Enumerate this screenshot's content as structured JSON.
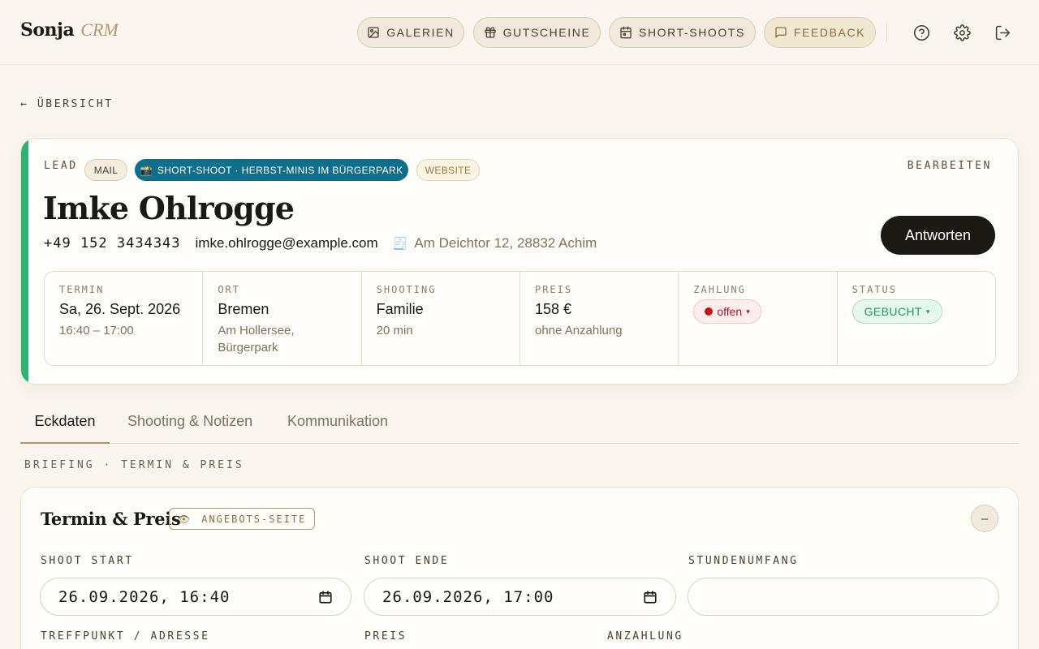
{
  "brand": {
    "name": "Sonja",
    "suffix": "CRM"
  },
  "nav": {
    "galerien": "GALERIEN",
    "gutscheine": "GUTSCHEINE",
    "short_shoots": "SHORT-SHOOTS",
    "feedback": "FEEDBACK"
  },
  "back_link": "← ÜBERSICHT",
  "lead": {
    "label": "LEAD",
    "chips": {
      "mail": "MAIL",
      "shoot": "SHORT-SHOOT · HERBST-MINIS IM BÜRGERPARK",
      "shoot_emoji": "📸",
      "source": "WEBSITE"
    },
    "edit": "BEARBEITEN",
    "name": "Imke Ohlrogge",
    "phone": "+49 152 3434343",
    "email": "imke.ohlrogge@example.com",
    "address": "Am Deichtor 12, 28832 Achim",
    "address_icon": "🧾",
    "reply_button": "Antworten",
    "accent_color": "#2db37a"
  },
  "facts": {
    "termin": {
      "label": "TERMIN",
      "main": "Sa, 26. Sept. 2026",
      "sub": "16:40 – 17:00"
    },
    "ort": {
      "label": "ORT",
      "main": "Bremen",
      "sub": "Am Hollersee, Bürgerpark"
    },
    "shooting": {
      "label": "SHOOTING",
      "main": "Familie",
      "sub": "20 min"
    },
    "preis": {
      "label": "PREIS",
      "main": "158 €",
      "sub": "ohne Anzahlung"
    },
    "zahlung": {
      "label": "ZAHLUNG",
      "value": "offen",
      "caret": "▾"
    },
    "status": {
      "label": "STATUS",
      "value": "GEBUCHT",
      "caret": "▾"
    }
  },
  "tabs": {
    "eckdaten": "Eckdaten",
    "shooting": "Shooting & Notizen",
    "kommunikation": "Kommunikation"
  },
  "section_label": "BRIEFING · TERMIN & PREIS",
  "panel": {
    "title": "Termin & Preis",
    "badge": "ANGEBOTS-SEITE",
    "badge_icon": "👁",
    "collapse": "–",
    "fields": {
      "shoot_start": {
        "label": "SHOOT START",
        "value": "26.09.2026, 16:40"
      },
      "shoot_ende": {
        "label": "SHOOT ENDE",
        "value": "26.09.2026, 17:00"
      },
      "stundenumfang": {
        "label": "STUNDENUMFANG",
        "value": ""
      },
      "treffpunkt": {
        "label": "TREFFPUNKT / ADRESSE"
      },
      "preis": {
        "label": "PREIS"
      },
      "anzahlung": {
        "label": "ANZAHLUNG"
      }
    }
  }
}
